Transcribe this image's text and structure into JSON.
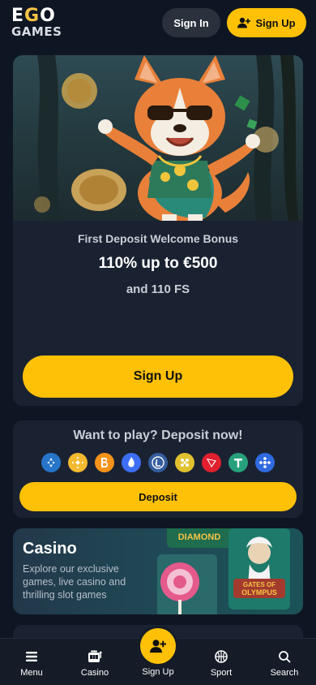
{
  "header": {
    "logo_line1_a": "E",
    "logo_line1_b": "G",
    "logo_line1_c": "O",
    "logo_line2": "GAMES",
    "signin_label": "Sign In",
    "signup_label": "Sign Up"
  },
  "promo": {
    "subtitle": "First Deposit Welcome Bonus",
    "amount": "110% up to €500",
    "free_spins": "and 110 FS",
    "cta_label": "Sign Up"
  },
  "deposit": {
    "title": "Want to play? Deposit now!",
    "button_label": "Deposit",
    "coins": [
      {
        "icon": "usdc-icon",
        "color": "#2775ca"
      },
      {
        "icon": "bnb-icon",
        "color": "#f3ba2f"
      },
      {
        "icon": "bitcoin-icon",
        "color": "#f7931a"
      },
      {
        "icon": "bonk-icon",
        "color": "#3d6ff5"
      },
      {
        "icon": "litecoin-icon",
        "color": "#345d9d"
      },
      {
        "icon": "dogecoin-icon",
        "color": "#e1c12f"
      },
      {
        "icon": "tron-icon",
        "color": "#e0202f"
      },
      {
        "icon": "tether-icon",
        "color": "#26a17b"
      },
      {
        "icon": "ripple-icon",
        "color": "#2f6ae0"
      }
    ]
  },
  "casino": {
    "title": "Casino",
    "description": "Explore our exclusive games, live casino and thrilling slot games",
    "art_label_1": "DIAMOND",
    "art_label_2": "GATES OF OLYMPUS"
  },
  "nav": {
    "menu": "Menu",
    "casino": "Casino",
    "signup": "Sign Up",
    "sport": "Sport",
    "search": "Search"
  },
  "colors": {
    "accent": "#ffc107",
    "background": "#0f1623",
    "card": "#1a2232"
  }
}
